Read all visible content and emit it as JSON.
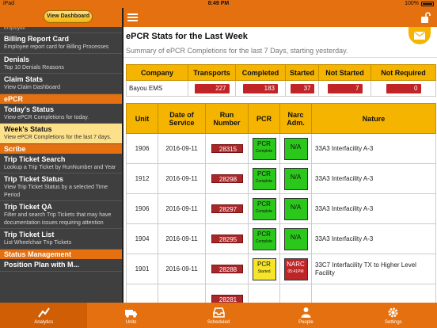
{
  "status_bar": {
    "left": "iPad",
    "time": "8:49 PM",
    "battery": "100%"
  },
  "sidebar": {
    "dashboard_button": "View Dashboard",
    "partial_top": "Employee",
    "items_group1": [
      {
        "title": "Billing Report Card",
        "sub": "Employee report card for Billing Processes"
      },
      {
        "title": "Denials",
        "sub": "Top 10 Denials Reasons"
      },
      {
        "title": "Claim Stats",
        "sub": "View Claim Dashboard"
      }
    ],
    "section_epcr": "ePCR",
    "items_epcr": [
      {
        "title": "Today's Status",
        "sub": "View ePCR Completions for today."
      },
      {
        "title": "Week's Status",
        "sub": "View ePCR Completions for the last 7 days."
      }
    ],
    "section_scribe": "Scribe",
    "items_scribe": [
      {
        "title": "Trip Ticket Search",
        "sub": "Lookup a Trip Ticket by RunNumber and Year"
      },
      {
        "title": "Trip Ticket Status",
        "sub": "View Trip Ticket Status by a selected Time Period"
      },
      {
        "title": "Trip Ticket QA",
        "sub": "Filter and search Trip Tickets that may have documentation issues requiring attention"
      },
      {
        "title": "Trip Ticket List",
        "sub": "List Wheelchair Trip Tickets"
      }
    ],
    "section_status": "Status Management",
    "partial_bottom": "Position Plan with M..."
  },
  "main": {
    "title": "ePCR Stats for the Last Week",
    "subtitle": "Summary of ePCR Completions for the last 7 Days, starting yesterday.",
    "summary_headers": [
      "Company",
      "Transports",
      "Completed",
      "Started",
      "Not Started",
      "Not Required"
    ],
    "summary_row": {
      "company": "Bayou EMS",
      "transports": "227",
      "completed": "183",
      "started": "37",
      "not_started": "7",
      "not_required": "0"
    },
    "run_headers": {
      "unit": "Unit",
      "date": "Date of Service",
      "run": "Run Number",
      "pcr": "PCR",
      "narc": "Narc Adm.",
      "nature": "Nature"
    },
    "runs": [
      {
        "unit": "1906",
        "date": "2016-09-11",
        "run": "28315",
        "pcr": "PCR",
        "pcr_sub": "Complete",
        "narc": "N/A",
        "narc_sub": "",
        "nature": "33A3 Interfacility A-3"
      },
      {
        "unit": "1912",
        "date": "2016-09-11",
        "run": "28298",
        "pcr": "PCR",
        "pcr_sub": "Complete",
        "narc": "N/A",
        "narc_sub": "",
        "nature": "33A3 Interfacility A-3"
      },
      {
        "unit": "1906",
        "date": "2016-09-11",
        "run": "28297",
        "pcr": "PCR",
        "pcr_sub": "Complete",
        "narc": "N/A",
        "narc_sub": "",
        "nature": "33A3 Interfacility A-3"
      },
      {
        "unit": "1904",
        "date": "2016-09-11",
        "run": "28295",
        "pcr": "PCR",
        "pcr_sub": "Complete",
        "narc": "N/A",
        "narc_sub": "",
        "nature": "33A3 Interfacility A-3"
      },
      {
        "unit": "1901",
        "date": "2016-09-11",
        "run": "28288",
        "pcr": "PCR",
        "pcr_sub": "Started",
        "narc": "NARC",
        "narc_sub": "05:41PM",
        "nature": "33C7 Interfacility TX to Higher Level Facility"
      }
    ],
    "partial_run": "28281"
  },
  "tabs": [
    {
      "label": "Analytics",
      "icon": "analytics-icon",
      "active": true
    },
    {
      "label": "Units",
      "icon": "ambulance-icon",
      "active": false
    },
    {
      "label": "Scheduled",
      "icon": "inbox-icon",
      "active": false
    },
    {
      "label": "People",
      "icon": "person-icon",
      "active": false
    },
    {
      "label": "Settings",
      "icon": "gear-icon",
      "active": false
    }
  ],
  "colors": {
    "accent": "#e4700f",
    "header": "#f5b400",
    "complete": "#2ac81a",
    "started": "#f7e52a",
    "alert": "#c02426"
  }
}
